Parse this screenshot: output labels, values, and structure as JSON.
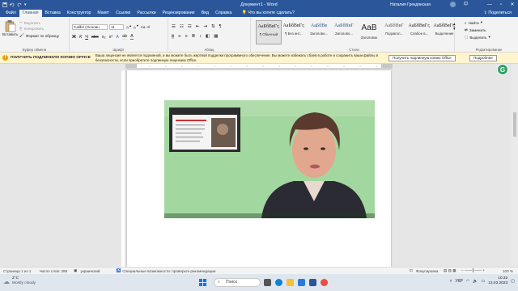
{
  "window": {
    "title": "Документ1 - Word",
    "user": "Наталия Грекдянская"
  },
  "tabs": [
    "Файл",
    "Главная",
    "Вставка",
    "Конструктор",
    "Макет",
    "Ссылки",
    "Рассылки",
    "Рецензирование",
    "Вид",
    "Справка"
  ],
  "active_tab_index": 1,
  "tell_me": "Что вы хотите сделать?",
  "share_label": "Поделиться",
  "ribbon": {
    "clipboard": {
      "paste": "Вставить",
      "cut": "Вырезать",
      "copy": "Копировать",
      "format_painter": "Формат по образцу",
      "group_label": "Буфер обмена"
    },
    "font": {
      "font_name": "Calibri (Основн",
      "font_size": "11",
      "group_label": "Шрифт"
    },
    "paragraph": {
      "group_label": "Абзац"
    },
    "styles": {
      "items": [
        {
          "sample": "АаБбВвГг,",
          "name": "¶ Обычный"
        },
        {
          "sample": "АаБбВвГг,",
          "name": "¶ Без инт..."
        },
        {
          "sample": "АаБбВв",
          "name": "Заголово..."
        },
        {
          "sample": "АаБбВвГ",
          "name": "Заголово..."
        },
        {
          "sample": "АаВ",
          "name": "Заголовок"
        },
        {
          "sample": "АаБбВвГ",
          "name": "Подзагол..."
        },
        {
          "sample": "АаБбВвГг,",
          "name": "Слабое в..."
        },
        {
          "sample": "АаБбВвГг,",
          "name": "Выделение"
        }
      ],
      "group_label": "Стили"
    },
    "editing": {
      "find": "Найти",
      "replace": "Заменить",
      "select": "Выделить",
      "group_label": "Редактирование"
    }
  },
  "message_bar": {
    "title": "ПОЛУЧИТЬ ПОДЛИННУЮ КОПИЮ OFFICE",
    "text": "Ваша лицензия не является подлинной, и вы можете быть жертвой подделки программного обеспечения. Вы можете избежать сбоев в работе и сохранить ваши файлы в безопасности, если приобретете подлинную лицензию Office.",
    "button_get": "Получить подлинную копию Office",
    "button_more": "Подробнее"
  },
  "avatar_letter": "G",
  "status": {
    "page": "Страница 1 из 1",
    "words": "Число слов: 288",
    "language": "украинский",
    "accessibility": "Специальные возможности: проверьте рекомендации",
    "focus": "Фокусировка",
    "zoom": "100 %"
  },
  "taskbar": {
    "temperature": "2°C",
    "weather": "Mostly cloudy",
    "search": "Поиск",
    "lang": "УКР",
    "time": "10:32",
    "date": "13.03.2023"
  }
}
